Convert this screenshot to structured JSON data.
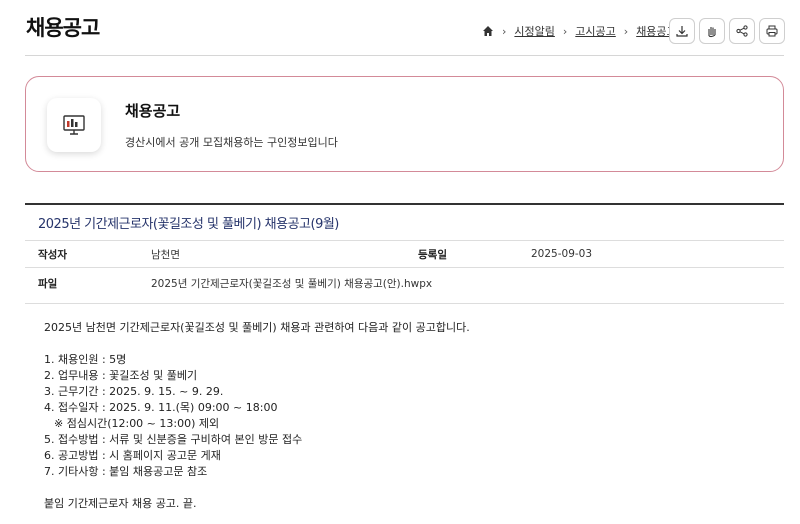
{
  "page": {
    "title": "채용공고"
  },
  "breadcrumb": {
    "items": [
      "시정알림",
      "고시공고",
      "채용공고"
    ]
  },
  "tools": [
    "download-icon",
    "hand-icon",
    "share-icon",
    "print-icon"
  ],
  "intro": {
    "title": "채용공고",
    "description": "경산시에서 공개 모집채용하는 구인정보입니다"
  },
  "post": {
    "title": "2025년 기간제근로자(꽃길조성 및 풀베기) 채용공고(9월)",
    "author_label": "작성자",
    "author": "남천면",
    "date_label": "등록일",
    "date": "2025-09-03",
    "file_label": "파일",
    "file_name": "2025년 기간제근로자(꽃길조성 및 풀베기) 채용공고(안).hwpx"
  },
  "content": {
    "intro": "2025년 남천면 기간제근로자(꽃길조성 및 풀베기) 채용과 관련하여 다음과 같이 공고합니다.",
    "items": [
      "1. 채용인원 : 5명",
      "2. 업무내용 : 꽃길조성 및 풀베기",
      "3. 근무기간 : 2025. 9. 15. ~ 9. 29.",
      "4. 접수일자 : 2025. 9. 11.(목) 09:00 ~ 18:00"
    ],
    "note": "※  점심시간(12:00 ~ 13:00) 제외",
    "items2": [
      "5. 접수방법 : 서류 및 신분증을 구비하여 본인 방문 접수",
      "6. 공고방법 : 시 홈페이지 공고문 게재",
      "7. 기타사항 : 붙임 채용공고문 참조"
    ],
    "closing": "붙임  기간제근로자 채용 공고.  끝."
  }
}
